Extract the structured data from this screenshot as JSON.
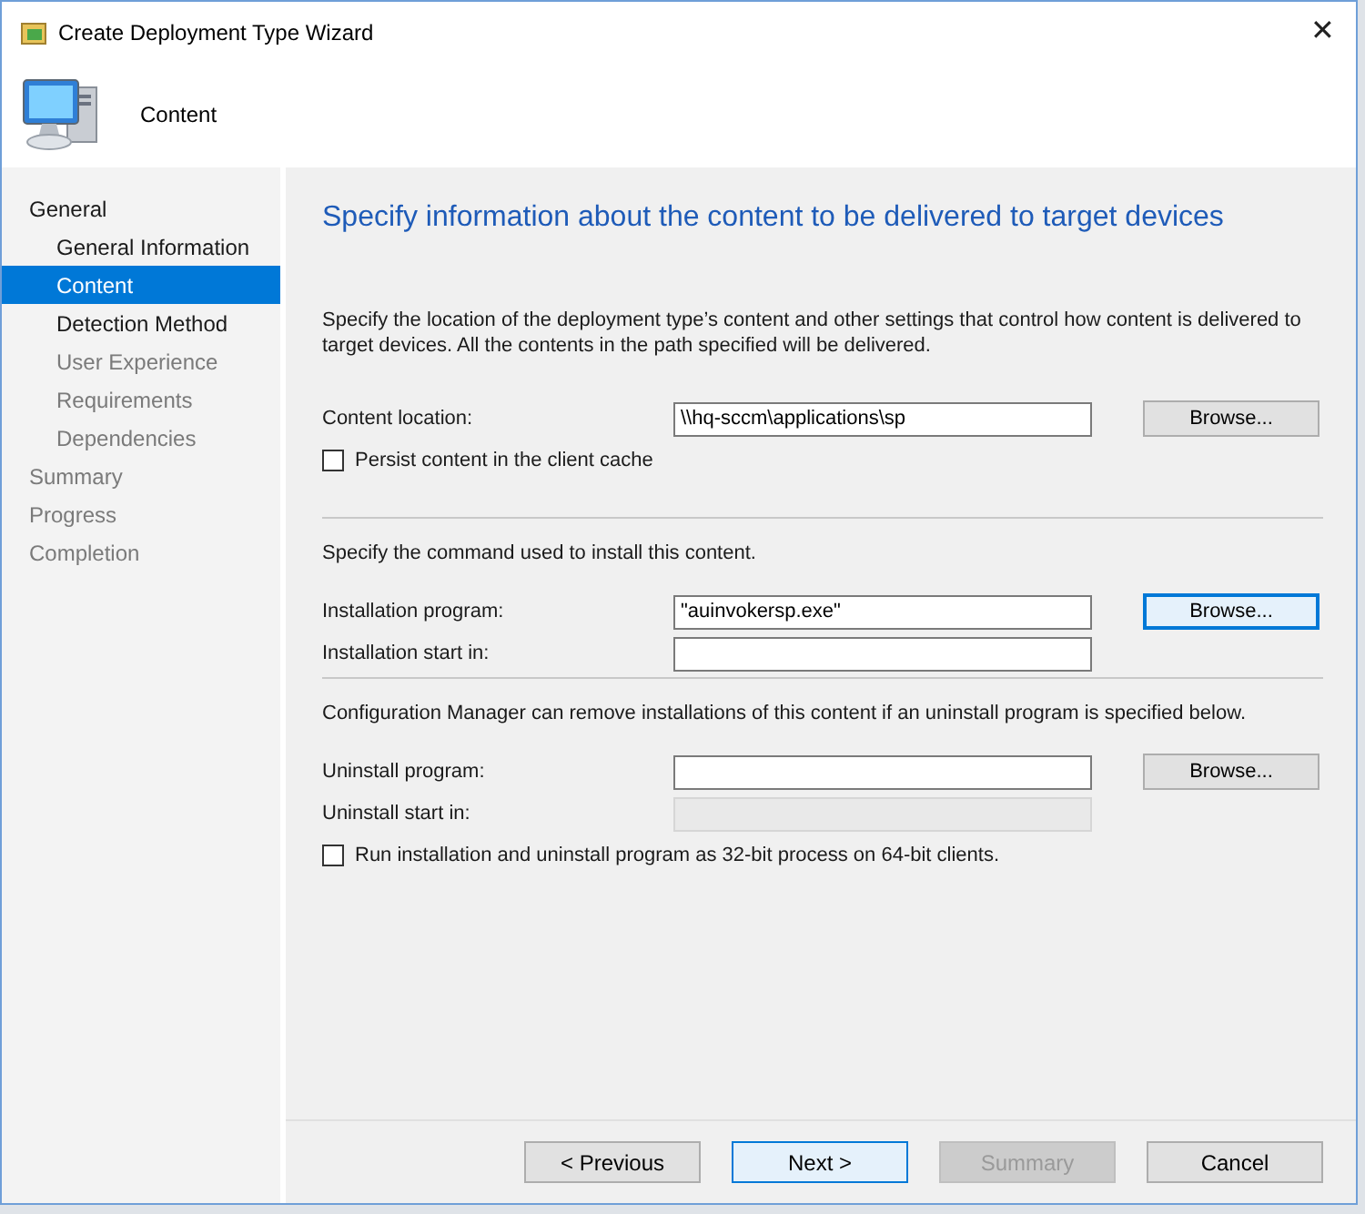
{
  "window": {
    "title": "Create Deployment Type Wizard",
    "close": "✕"
  },
  "header": {
    "title": "Content"
  },
  "sidebar": {
    "items": [
      {
        "label": "General",
        "selected": false,
        "disabled": false,
        "children": [
          {
            "label": "General Information",
            "selected": false,
            "disabled": false
          },
          {
            "label": "Content",
            "selected": true,
            "disabled": false
          },
          {
            "label": "Detection Method",
            "selected": false,
            "disabled": false
          },
          {
            "label": "User Experience",
            "selected": false,
            "disabled": true
          },
          {
            "label": "Requirements",
            "selected": false,
            "disabled": true
          },
          {
            "label": "Dependencies",
            "selected": false,
            "disabled": true
          }
        ]
      },
      {
        "label": "Summary",
        "selected": false,
        "disabled": true
      },
      {
        "label": "Progress",
        "selected": false,
        "disabled": true
      },
      {
        "label": "Completion",
        "selected": false,
        "disabled": true
      }
    ]
  },
  "page": {
    "heading": "Specify information about the content to be delivered to target devices",
    "intro": "Specify the location of the deployment type’s content and other settings that control how content is delivered to target devices. All the contents in the path specified will be delivered.",
    "rows": [
      {
        "kind": "field",
        "label": "Content location:",
        "value": "\\\\hq-sccm\\applications\\sp",
        "disabled": false,
        "button": {
          "label": "Browse...",
          "focused": false
        }
      },
      {
        "kind": "checkbox",
        "label": "Persist content in the client cache",
        "checked": false
      },
      {
        "kind": "section",
        "text": "Specify the command used to install this content."
      },
      {
        "kind": "field",
        "label": "Installation program:",
        "value": "\"auinvokersp.exe\"",
        "disabled": false,
        "button": {
          "label": "Browse...",
          "focused": true
        }
      },
      {
        "kind": "field",
        "label": "Installation start in:",
        "disabled": false
      },
      {
        "kind": "section",
        "text": "Configuration Manager can remove installations of this content if an uninstall program is specified below."
      },
      {
        "kind": "field",
        "label": "Uninstall program:",
        "disabled": false,
        "button": {
          "label": "Browse...",
          "focused": false
        }
      },
      {
        "kind": "field",
        "label": "Uninstall start in:",
        "disabled": true
      },
      {
        "kind": "checkbox",
        "label": "Run installation and uninstall program as 32-bit process on 64-bit clients.",
        "checked": false
      }
    ]
  },
  "buttons": [
    {
      "label": "< Previous",
      "disabled": false,
      "focused": false
    },
    {
      "label": "Next >",
      "disabled": false,
      "focused": true
    },
    {
      "label": "Summary",
      "disabled": true,
      "focused": false
    },
    {
      "label": "Cancel",
      "disabled": false,
      "focused": false
    }
  ]
}
